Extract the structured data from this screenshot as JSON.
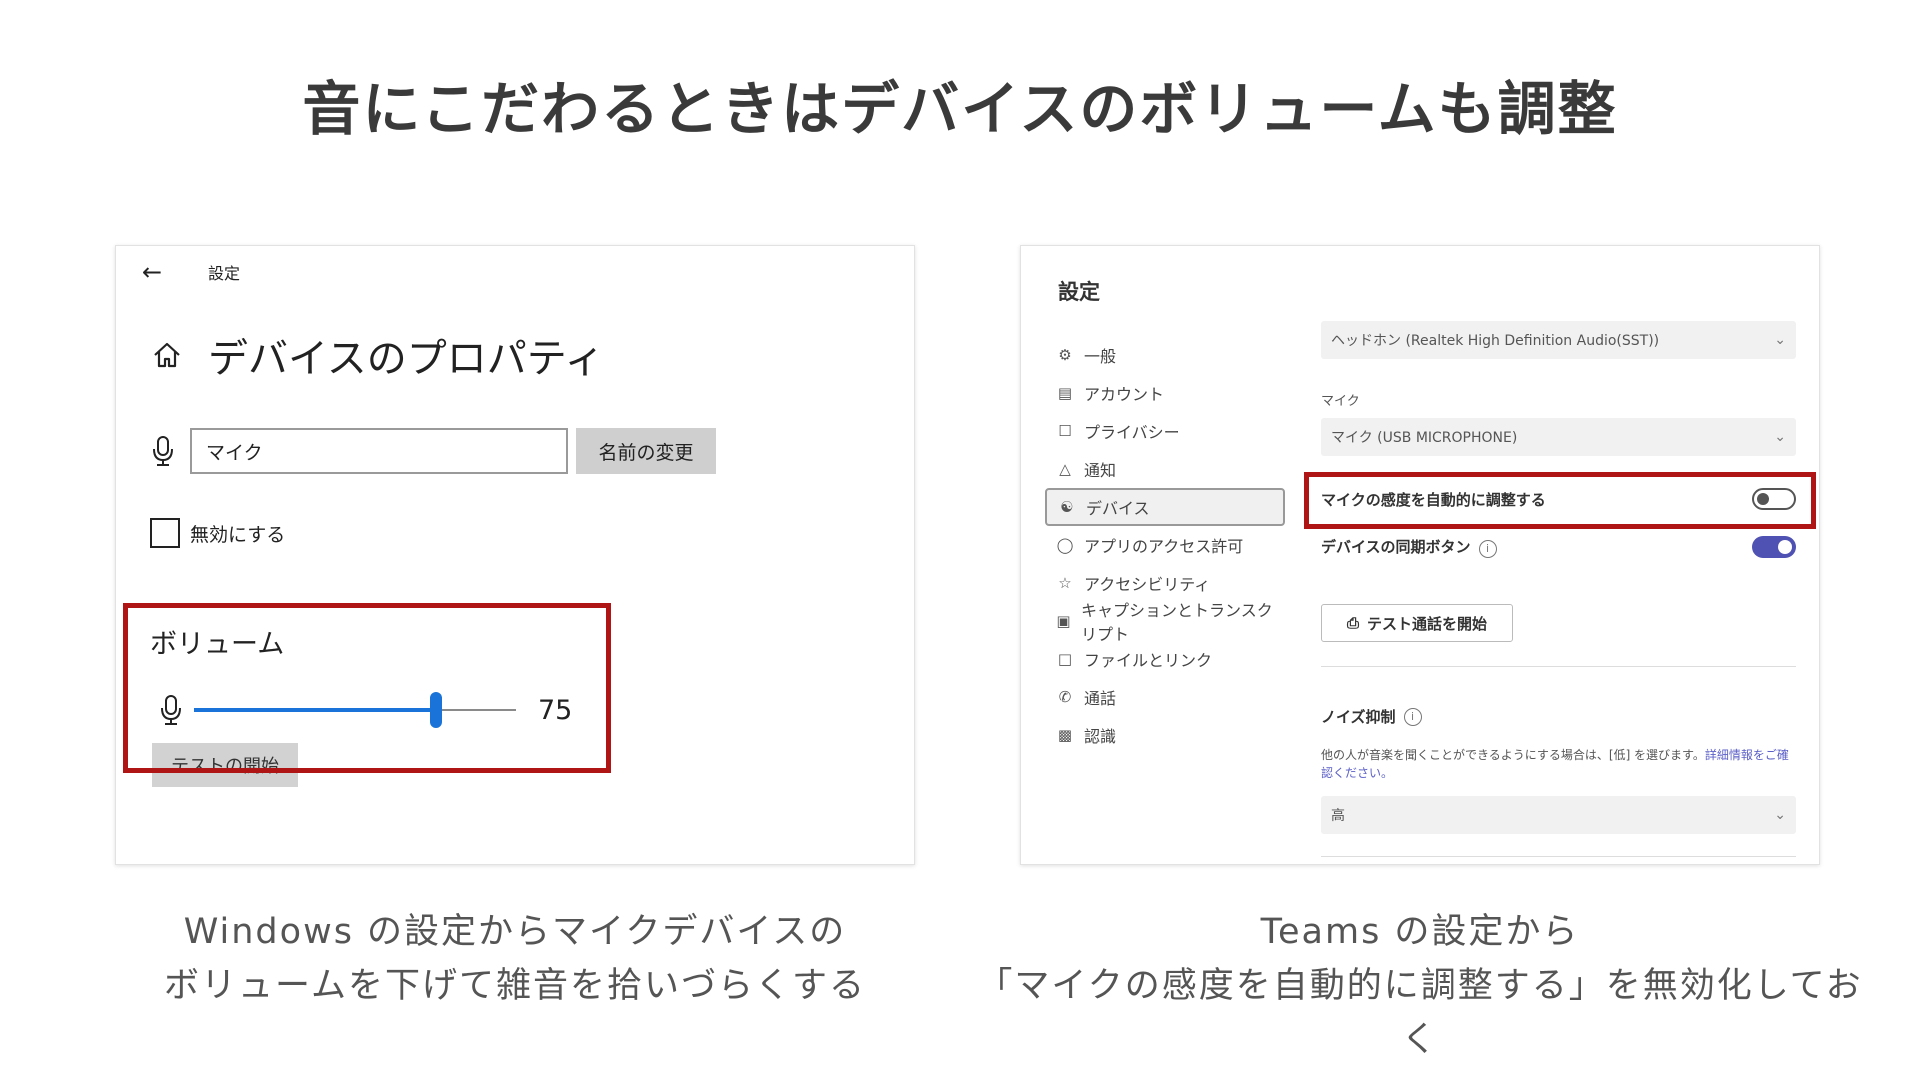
{
  "title": "音にこだわるときはデバイスのボリュームも調整",
  "left_panel": {
    "topbar_label": "設定",
    "heading": "デバイスのプロパティ",
    "name_input_value": "マイク",
    "rename_button": "名前の変更",
    "disable_checkbox_label": "無効にする",
    "disable_checked": false,
    "volume_label": "ボリューム",
    "volume_value": "75",
    "volume_level": 0.75,
    "test_button": "テストの開始",
    "accent_color": "#1a73d9",
    "highlight_color": "#b01515"
  },
  "right_panel": {
    "title": "設定",
    "nav": [
      {
        "label": "一般",
        "icon": "gear-icon"
      },
      {
        "label": "アカウント",
        "icon": "id-card-icon"
      },
      {
        "label": "プライバシー",
        "icon": "lock-icon"
      },
      {
        "label": "通知",
        "icon": "bell-icon"
      },
      {
        "label": "デバイス",
        "icon": "headset-icon",
        "selected": true
      },
      {
        "label": "アプリのアクセス許可",
        "icon": "shield-icon"
      },
      {
        "label": "アクセシビリティ",
        "icon": "accessibility-icon"
      },
      {
        "label": "キャプションとトランスクリプト",
        "icon": "captions-icon"
      },
      {
        "label": "ファイルとリンク",
        "icon": "file-icon"
      },
      {
        "label": "通話",
        "icon": "phone-icon"
      },
      {
        "label": "認識",
        "icon": "recognition-icon"
      }
    ],
    "speaker_dropdown": "ヘッドホン (Realtek High Definition Audio(SST))",
    "mic_label": "マイク",
    "mic_dropdown": "マイク (USB MICROPHONE)",
    "auto_adjust_label": "マイクの感度を自動的に調整する",
    "auto_adjust_on": false,
    "sync_buttons_label": "デバイスの同期ボタン",
    "sync_buttons_on": true,
    "test_call_button": "テスト通話を開始",
    "noise_label": "ノイズ抑制",
    "noise_desc": "他の人が音楽を聞くことができるようにする場合は、[低] を選びます。",
    "noise_link": "詳細情報をご確認ください。",
    "noise_dropdown": "高",
    "toggle_on_color": "#4f52b2"
  },
  "captions": {
    "left_line1": "Windows の設定からマイクデバイスの",
    "left_line2": "ボリュームを下げて雑音を拾いづらくする",
    "right_line1": "Teams の設定から",
    "right_line2": "「マイクの感度を自動的に調整する」を無効化しておく"
  }
}
